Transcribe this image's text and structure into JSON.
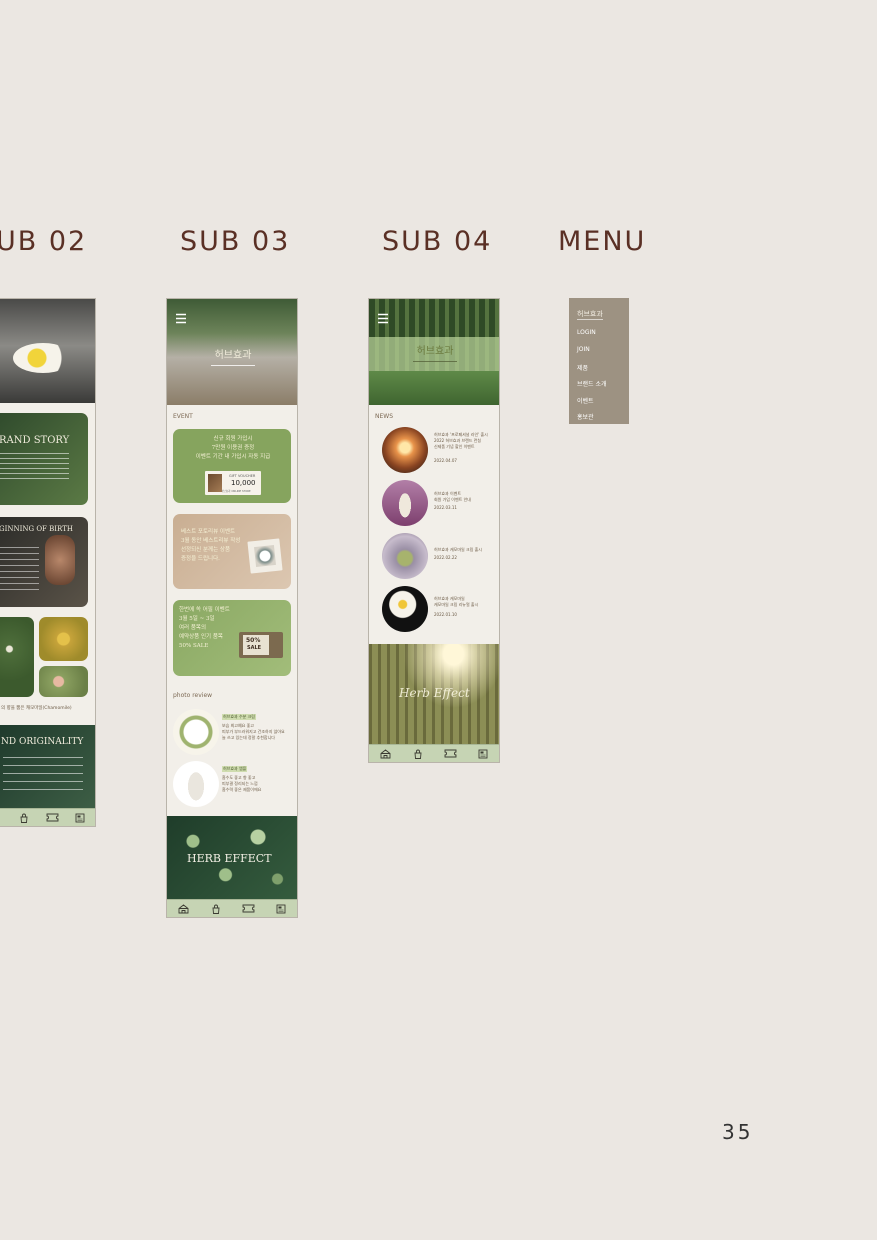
{
  "headings": {
    "sub02": "UB 02",
    "sub03": "SUB 03",
    "sub04": "SUB 04",
    "menu": "MENU"
  },
  "page_number": "35",
  "sub02": {
    "cards": [
      {
        "title": "RAND STORY"
      },
      {
        "title": "GINNING OF BIRTH"
      }
    ],
    "caption": "의 향을 뿜은 캐모마일(Chamomile)",
    "origin_title": "ND ORIGINALITY"
  },
  "sub03": {
    "event_label": "EVENT",
    "events": [
      {
        "text": "신규 회원 가입시\n7만원 이용권 증정\n이벤트 기간 내 가입시 자동 지급",
        "voucher_top": "GIFT VOUCHER",
        "voucher_value": "10,000",
        "voucher_sub": "허브효과 ONLINE STORE"
      },
      {
        "text": "베스트 포토리뷰 이벤트\n3월 동안 베스트리뷰 작성\n선정되신 분께는 상품\n증정을 드립니다.",
        "badge": ""
      },
      {
        "text": "한번에 쏙 어필 이벤트\n3월 5일 ~ 3일\n여러 품목의\n예약상품 인기 품목\n50% SALE",
        "coupon_top": "50%",
        "coupon_bottom": "SALE"
      }
    ],
    "review_label": "photo review",
    "reviews": [
      {
        "tag": "허브효과 수분 크림",
        "text": "보습 최고예요 좋고\n피부가 부드러워지고 건조하지 않아요\n늘 쓰고 있는데 정말 추천합니다"
      },
      {
        "tag": "허브효과 앰플",
        "text": "흡수도 좋고 향 좋고\n피부결 정리되는 느낌\n흡수력 좋은 제품이에요"
      }
    ],
    "banner_text": "HERB EFFECT"
  },
  "sub04": {
    "news_label": "NEWS",
    "news": [
      {
        "text": "허브효과 '프로페셔널 라인' 출시\n2022 허브효과 브랜드 런칭\n신제품 기념 할인 이벤트",
        "date": "2022.04.07"
      },
      {
        "text": "허브효과 이벤트\n회원 가입 이벤트 안내",
        "date": "2022.03.11"
      },
      {
        "text": "허브효과 캐모마일 크림 출시",
        "date": "2022.02.22"
      },
      {
        "text": "허브효과 캐모마일\n캐모마일 크림 리뉴얼 출시",
        "date": "2022.01.10"
      }
    ],
    "banner_text": "Herb Effect"
  },
  "menu": {
    "logo": "허브효과",
    "items": [
      "LOGIN",
      "JOIN",
      "제품",
      "브랜드 소개",
      "이벤트",
      "홍보관"
    ]
  },
  "colors": {
    "background": "#ebe7e2",
    "heading": "#5a3025",
    "nav_bar": "#c6d4b4",
    "event_green": "#86a45e",
    "event_beige": "#c9ae92",
    "menu_panel": "#9d9282"
  },
  "icons": [
    "home-icon",
    "bag-icon",
    "ticket-icon",
    "news-icon",
    "hamburger-icon"
  ]
}
